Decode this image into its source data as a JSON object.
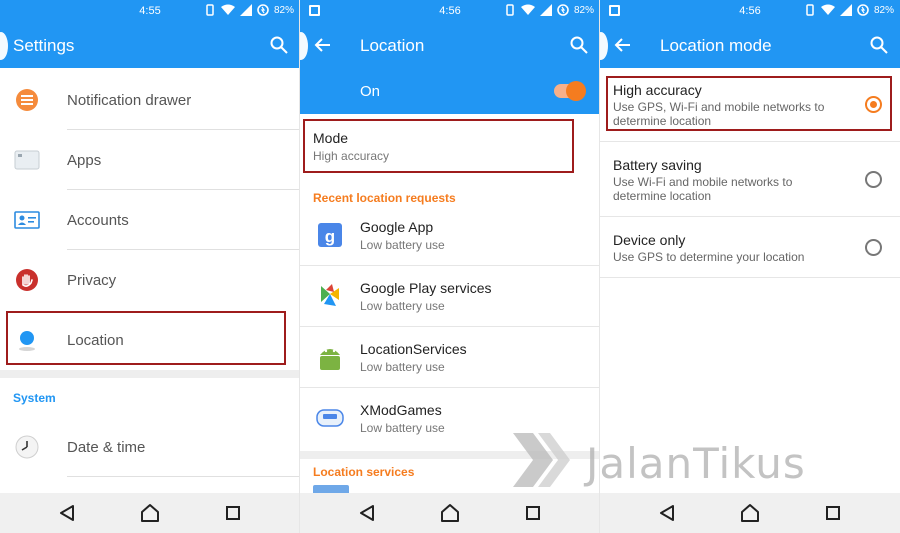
{
  "status_bars": [
    {
      "time": "4:55",
      "battery": "82%"
    },
    {
      "time": "4:56",
      "battery": "82%"
    },
    {
      "time": "4:56",
      "battery": "82%"
    }
  ],
  "settings": {
    "title": "Settings",
    "items": [
      {
        "label": "Notification drawer",
        "icon": "notification-drawer-icon"
      },
      {
        "label": "Apps",
        "icon": "apps-icon"
      },
      {
        "label": "Accounts",
        "icon": "accounts-icon"
      },
      {
        "label": "Privacy",
        "icon": "privacy-hand-icon"
      },
      {
        "label": "Location",
        "icon": "location-pin-icon"
      }
    ],
    "system_header": "System",
    "system_items": [
      {
        "label": "Date & time",
        "icon": "clock-icon"
      }
    ]
  },
  "location": {
    "title": "Location",
    "toggle_label": "On",
    "toggle_state": "on",
    "mode_title": "Mode",
    "mode_value": "High accuracy",
    "recent_header": "Recent location requests",
    "requests": [
      {
        "name": "Google App",
        "detail": "Low battery use",
        "icon": "google-app-icon"
      },
      {
        "name": "Google Play services",
        "detail": "Low battery use",
        "icon": "google-play-services-icon"
      },
      {
        "name": "LocationServices",
        "detail": "Low battery use",
        "icon": "android-icon"
      },
      {
        "name": "XModGames",
        "detail": "Low battery use",
        "icon": "xmodgames-icon"
      }
    ],
    "services_header": "Location services"
  },
  "location_mode": {
    "title": "Location mode",
    "options": [
      {
        "title": "High accuracy",
        "description": "Use GPS, Wi-Fi and mobile networks to determine location",
        "selected": true
      },
      {
        "title": "Battery saving",
        "description": "Use Wi-Fi and mobile networks to determine location",
        "selected": false
      },
      {
        "title": "Device only",
        "description": "Use GPS to determine your location",
        "selected": false
      }
    ]
  },
  "watermark": {
    "text": "JalanTikus"
  },
  "colors": {
    "primary": "#2196f3",
    "accent": "#f57c1f",
    "highlight": "#9e1c1c"
  }
}
